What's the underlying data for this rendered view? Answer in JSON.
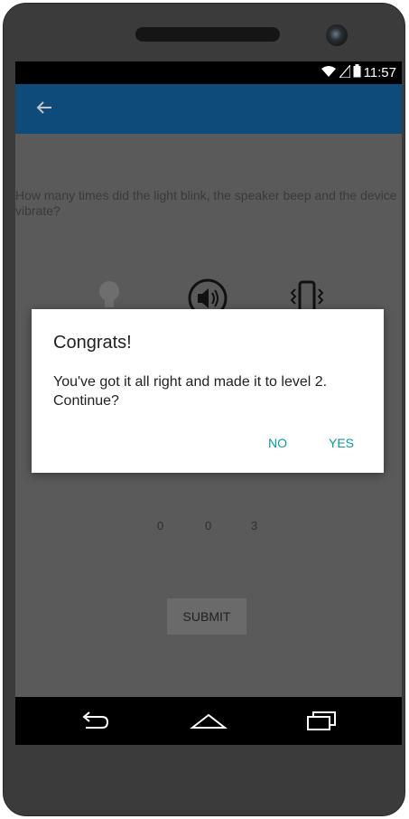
{
  "status_bar": {
    "time": "11:57"
  },
  "question": "How many times did the light blink, the speaker beep and the device vibrate?",
  "icons": {
    "light": "lightbulb-icon",
    "speaker": "speaker-icon",
    "vibrate": "vibrate-icon"
  },
  "counts": [
    "0",
    "0",
    "3"
  ],
  "submit_label": "SUBMIT",
  "dialog": {
    "title": "Congrats!",
    "message": "You've got it all right and made it to level 2. Continue?",
    "no_label": "NO",
    "yes_label": "YES"
  },
  "colors": {
    "app_bar": "#0e4a7a",
    "dialog_button": "#0d9a9a",
    "overlay_screen": "#5a5a5a"
  }
}
